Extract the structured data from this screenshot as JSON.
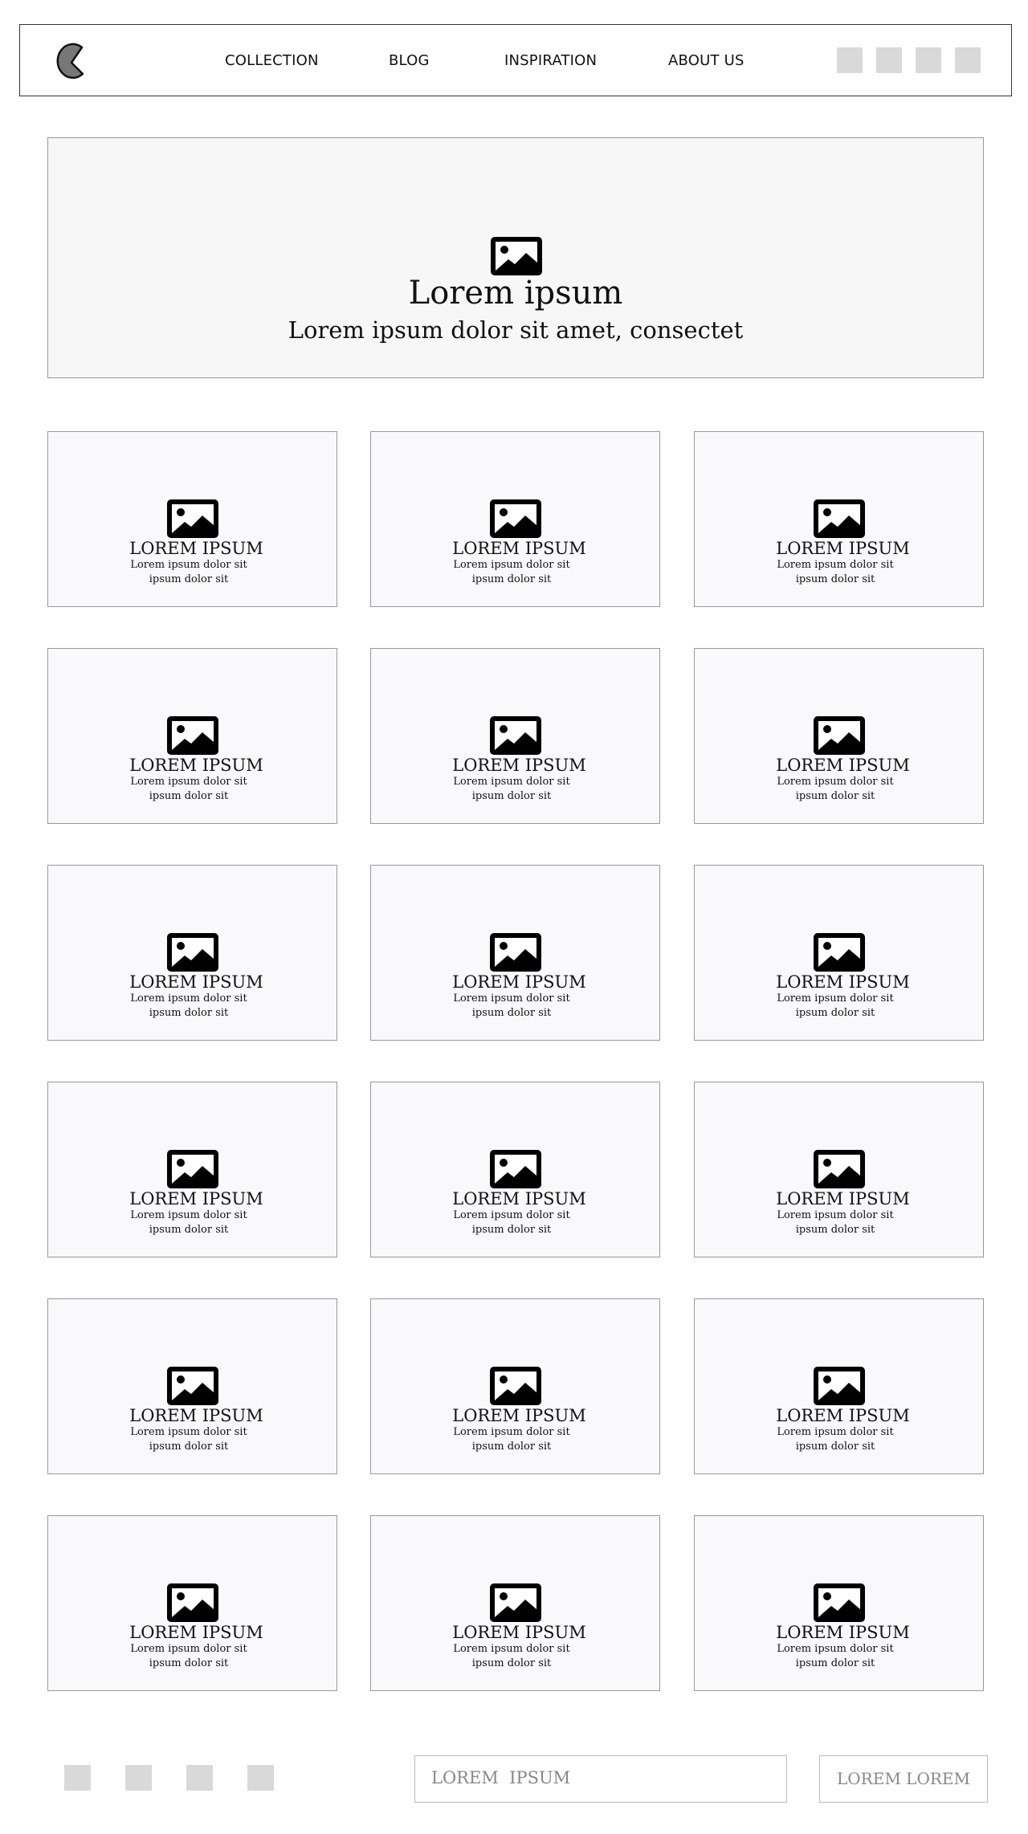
{
  "header": {
    "nav": [
      "COLLECTION",
      "BLOG",
      "INSPIRATION",
      "ABOUT US"
    ]
  },
  "hero": {
    "title": "Lorem ipsum",
    "subtitle": "Lorem ipsum dolor sit amet, consectet"
  },
  "cards": [
    {
      "title": "LOREM IPSUM",
      "desc": "Lorem ipsum dolor sit ipsum dolor sit"
    },
    {
      "title": "LOREM IPSUM",
      "desc": "Lorem ipsum dolor sit ipsum dolor sit"
    },
    {
      "title": "LOREM IPSUM",
      "desc": "Lorem ipsum dolor sit ipsum dolor sit"
    },
    {
      "title": "LOREM IPSUM",
      "desc": "Lorem ipsum dolor sit ipsum dolor sit"
    },
    {
      "title": "LOREM IPSUM",
      "desc": "Lorem ipsum dolor sit ipsum dolor sit"
    },
    {
      "title": "LOREM IPSUM",
      "desc": "Lorem ipsum dolor sit ipsum dolor sit"
    },
    {
      "title": "LOREM IPSUM",
      "desc": "Lorem ipsum dolor sit ipsum dolor sit"
    },
    {
      "title": "LOREM IPSUM",
      "desc": "Lorem ipsum dolor sit ipsum dolor sit"
    },
    {
      "title": "LOREM IPSUM",
      "desc": "Lorem ipsum dolor sit ipsum dolor sit"
    },
    {
      "title": "LOREM IPSUM",
      "desc": "Lorem ipsum dolor sit ipsum dolor sit"
    },
    {
      "title": "LOREM IPSUM",
      "desc": "Lorem ipsum dolor sit ipsum dolor sit"
    },
    {
      "title": "LOREM IPSUM",
      "desc": "Lorem ipsum dolor sit ipsum dolor sit"
    },
    {
      "title": "LOREM IPSUM",
      "desc": "Lorem ipsum dolor sit ipsum dolor sit"
    },
    {
      "title": "LOREM IPSUM",
      "desc": "Lorem ipsum dolor sit ipsum dolor sit"
    },
    {
      "title": "LOREM IPSUM",
      "desc": "Lorem ipsum dolor sit ipsum dolor sit"
    },
    {
      "title": "LOREM IPSUM",
      "desc": "Lorem ipsum dolor sit ipsum dolor sit"
    },
    {
      "title": "LOREM IPSUM",
      "desc": "Lorem ipsum dolor sit ipsum dolor sit"
    },
    {
      "title": "LOREM IPSUM",
      "desc": "Lorem ipsum dolor sit ipsum dolor sit"
    }
  ],
  "footer": {
    "input_value": "LOREM  IPSUM",
    "button_label": "LOREM LOREM"
  },
  "icons": {
    "logo": "pacman-logo-icon",
    "image": "image-placeholder-icon"
  },
  "colors": {
    "placeholder_gray": "#d9d9d9",
    "logo_fill": "#777777"
  }
}
